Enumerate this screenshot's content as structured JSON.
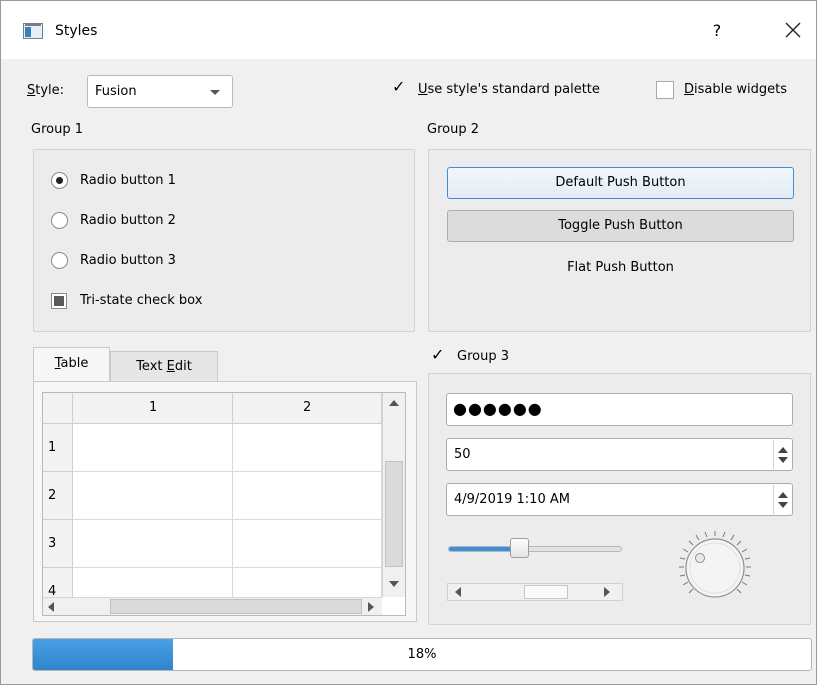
{
  "window": {
    "title": "Styles",
    "help_label": "?",
    "close_icon": "close-icon"
  },
  "top": {
    "style_label_accel": "S",
    "style_label_rest": "tyle:",
    "style_value": "Fusion",
    "use_palette_accel": "U",
    "use_palette_rest": "se style's standard palette",
    "use_palette_checked": true,
    "disable_widgets_accel": "D",
    "disable_widgets_rest": "isable widgets",
    "disable_widgets_checked": false
  },
  "group1": {
    "title": "Group 1",
    "radios": [
      {
        "label": "Radio button 1",
        "checked": true
      },
      {
        "label": "Radio button 2",
        "checked": false
      },
      {
        "label": "Radio button 3",
        "checked": false
      }
    ],
    "tristate_label": "Tri-state check box"
  },
  "group2": {
    "title": "Group 2",
    "default_button": "Default Push Button",
    "toggle_button": "Toggle Push Button",
    "flat_button": "Flat Push Button"
  },
  "tabs": {
    "table_accel": "T",
    "table_rest": "able",
    "textedit_prefix": "Text ",
    "textedit_accel": "E",
    "textedit_rest": "dit"
  },
  "table": {
    "columns": [
      "1",
      "2"
    ],
    "rows": [
      "1",
      "2",
      "3",
      "4"
    ]
  },
  "group3": {
    "title": "Group 3",
    "checked": true,
    "password_mask": "●●●●●●",
    "spin_value": "50",
    "datetime_value": "4/9/2019 1:10 AM",
    "slider_value": 0.38,
    "scroll_value": 0.5
  },
  "progress": {
    "value": 18,
    "text": "18%",
    "accent": "#3b8fd8"
  }
}
